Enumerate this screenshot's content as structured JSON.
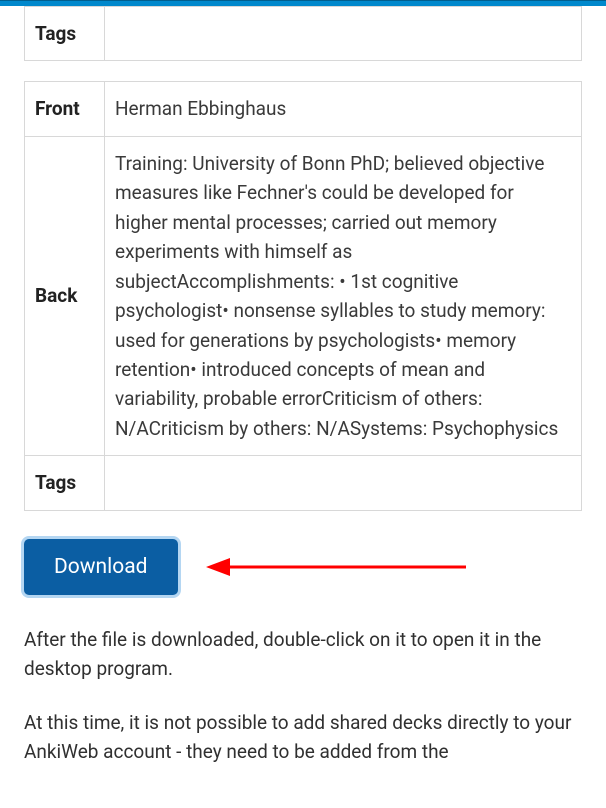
{
  "card1": {
    "tags_label": "Tags",
    "tags_value": ""
  },
  "card2": {
    "front_label": "Front",
    "front_value": "Herman Ebbinghaus",
    "back_label": "Back",
    "back_value": "Training: University of Bonn PhD; believed objective measures like Fechner's could be developed for higher mental processes; carried out memory experiments with himself as subjectAccomplishments:  • 1st cognitive psychologist• nonsense syllables to study memory: used for generations by psychologists• memory retention• introduced concepts of mean and variability, probable errorCriticism of others: N/ACriticism by others: N/ASystems: Psychophysics",
    "tags_label": "Tags",
    "tags_value": ""
  },
  "download": {
    "label": "Download"
  },
  "instructions": {
    "p1": "After the file is downloaded, double-click on it to open it in the desktop program.",
    "p2": "At this time, it is not possible to add shared decks directly to your AnkiWeb account - they need to be added from the"
  },
  "annotation": {
    "arrow_color": "#ff0000"
  }
}
